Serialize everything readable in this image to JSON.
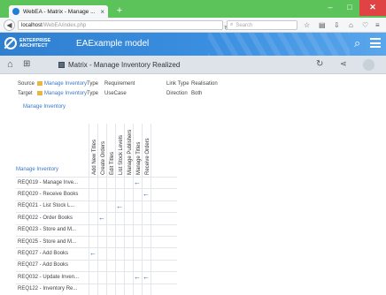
{
  "browser": {
    "tab_title": "WebEA - Matrix - Manage ...",
    "tab_close": "×",
    "new_tab": "+",
    "url_host": "localhost",
    "url_path": "/WebEA/index.php",
    "search_placeholder": "Search",
    "win_min": "–",
    "win_max": "□",
    "win_close": "✕"
  },
  "ea": {
    "brand_line1": "ENTERPRISE",
    "brand_line2": "ARCHITECT",
    "model_name": "EAExample model"
  },
  "toolbar": {
    "view_title": "Matrix - Manage Inventory Realized"
  },
  "meta": {
    "source_label": "Source",
    "source_pkg": "Manage Inventory",
    "source_type_label": "Type",
    "source_type": "Requirement",
    "link_type_label": "Link Type",
    "link_type": "Realisation",
    "target_label": "Target",
    "target_pkg": "Manage Inventory",
    "target_type_label": "Type",
    "target_type": "UseCase",
    "direction_label": "Direction",
    "direction": "Both",
    "package_link": "Manage Inventory"
  },
  "matrix": {
    "corner": "Manage Inventory",
    "columns": [
      "Add New Titles",
      "Create Orders",
      "Edit Titles",
      "List Stock Levels",
      "Manage Publishers",
      "Manage Titles",
      "Receive Orders"
    ],
    "rows": [
      {
        "label": "REQ019 - Manage Inve...",
        "cells": [
          0,
          0,
          0,
          0,
          0,
          1,
          0
        ]
      },
      {
        "label": "REQ020 - Receive Books",
        "cells": [
          0,
          0,
          0,
          0,
          0,
          0,
          1
        ]
      },
      {
        "label": "REQ021 - List Stock L...",
        "cells": [
          0,
          0,
          0,
          1,
          0,
          0,
          0
        ]
      },
      {
        "label": "REQ022 - Order Books",
        "cells": [
          0,
          1,
          0,
          0,
          0,
          0,
          0
        ]
      },
      {
        "label": "REQ023 - Store and M...",
        "cells": [
          0,
          0,
          0,
          0,
          0,
          0,
          0
        ]
      },
      {
        "label": "REQ025 - Store and M...",
        "cells": [
          0,
          0,
          0,
          0,
          0,
          0,
          0
        ]
      },
      {
        "label": "REQ027 - Add Books",
        "cells": [
          1,
          0,
          0,
          0,
          0,
          0,
          0
        ]
      },
      {
        "label": "REQ027 - Add Books",
        "cells": [
          0,
          0,
          0,
          0,
          0,
          0,
          0
        ]
      },
      {
        "label": "REQ032 - Update Inven...",
        "cells": [
          0,
          0,
          0,
          0,
          0,
          1,
          1
        ]
      },
      {
        "label": "REQ122 - Inventory Re...",
        "cells": [
          0,
          0,
          0,
          0,
          0,
          0,
          0
        ]
      }
    ],
    "arrow_glyph": "←"
  }
}
